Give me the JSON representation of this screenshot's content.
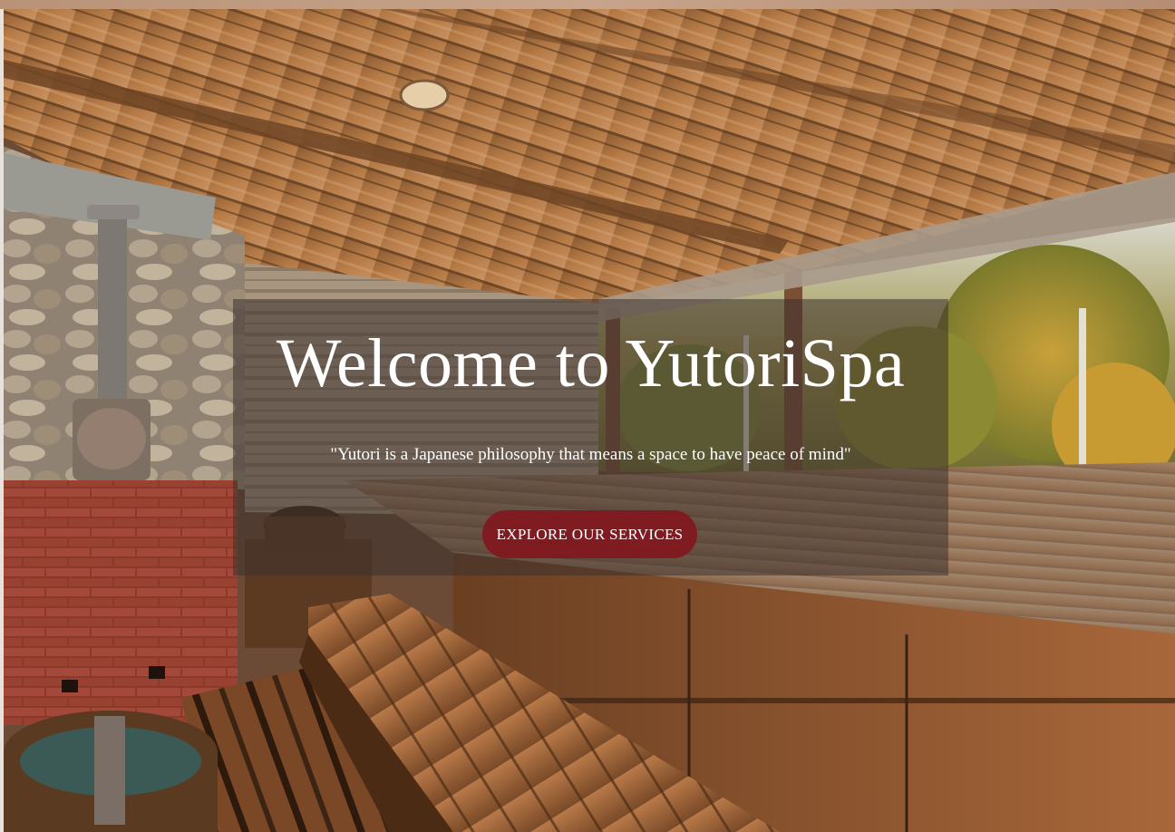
{
  "hero": {
    "title": "Welcome to YutoriSpa",
    "quote": "\"Yutori is a Japanese philosophy that means a space to have peace of mind\"",
    "cta_label": "EXPLORE OUR SERVICES",
    "background_image": "sauna-interior-photo"
  },
  "colors": {
    "cta_background": "#82161e",
    "text": "#ffffff",
    "overlay": "#3c322d"
  }
}
